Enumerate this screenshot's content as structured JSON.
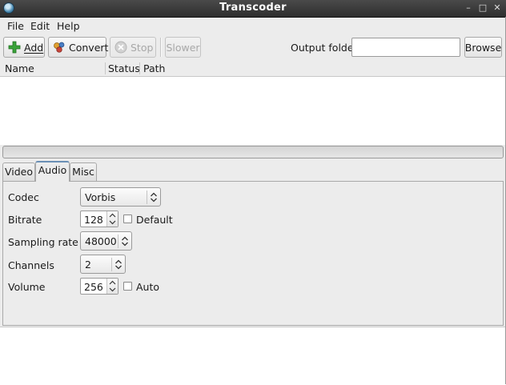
{
  "window": {
    "title": "Transcoder"
  },
  "menu": {
    "items": [
      "File",
      "Edit",
      "Help"
    ]
  },
  "toolbar": {
    "add_label": "Add",
    "convert_label": "Convert",
    "stop_label": "Stop",
    "slower_label": "Slower",
    "output_folder_label": "Output folder",
    "output_folder_value": "",
    "browse_label": "Browse"
  },
  "list": {
    "columns": [
      "Name",
      "Status",
      "Path"
    ],
    "rows": []
  },
  "tabs": [
    {
      "label": "Video",
      "active": false
    },
    {
      "label": "Audio",
      "active": true
    },
    {
      "label": "Misc",
      "active": false
    }
  ],
  "audio": {
    "codec_label": "Codec",
    "codec_value": "Vorbis",
    "bitrate_label": "Bitrate",
    "bitrate_value": "128",
    "bitrate_default_label": "Default",
    "bitrate_default_checked": false,
    "sampling_label": "Sampling rate",
    "sampling_value": "48000",
    "channels_label": "Channels",
    "channels_value": "2",
    "volume_label": "Volume",
    "volume_value": "256",
    "volume_auto_label": "Auto",
    "volume_auto_checked": false
  },
  "colors": {
    "titlebar": "#3a3a3a",
    "window_bg": "#ececec",
    "active_tab_accent": "#6a8fb5",
    "add_icon": "#3aa33a"
  }
}
